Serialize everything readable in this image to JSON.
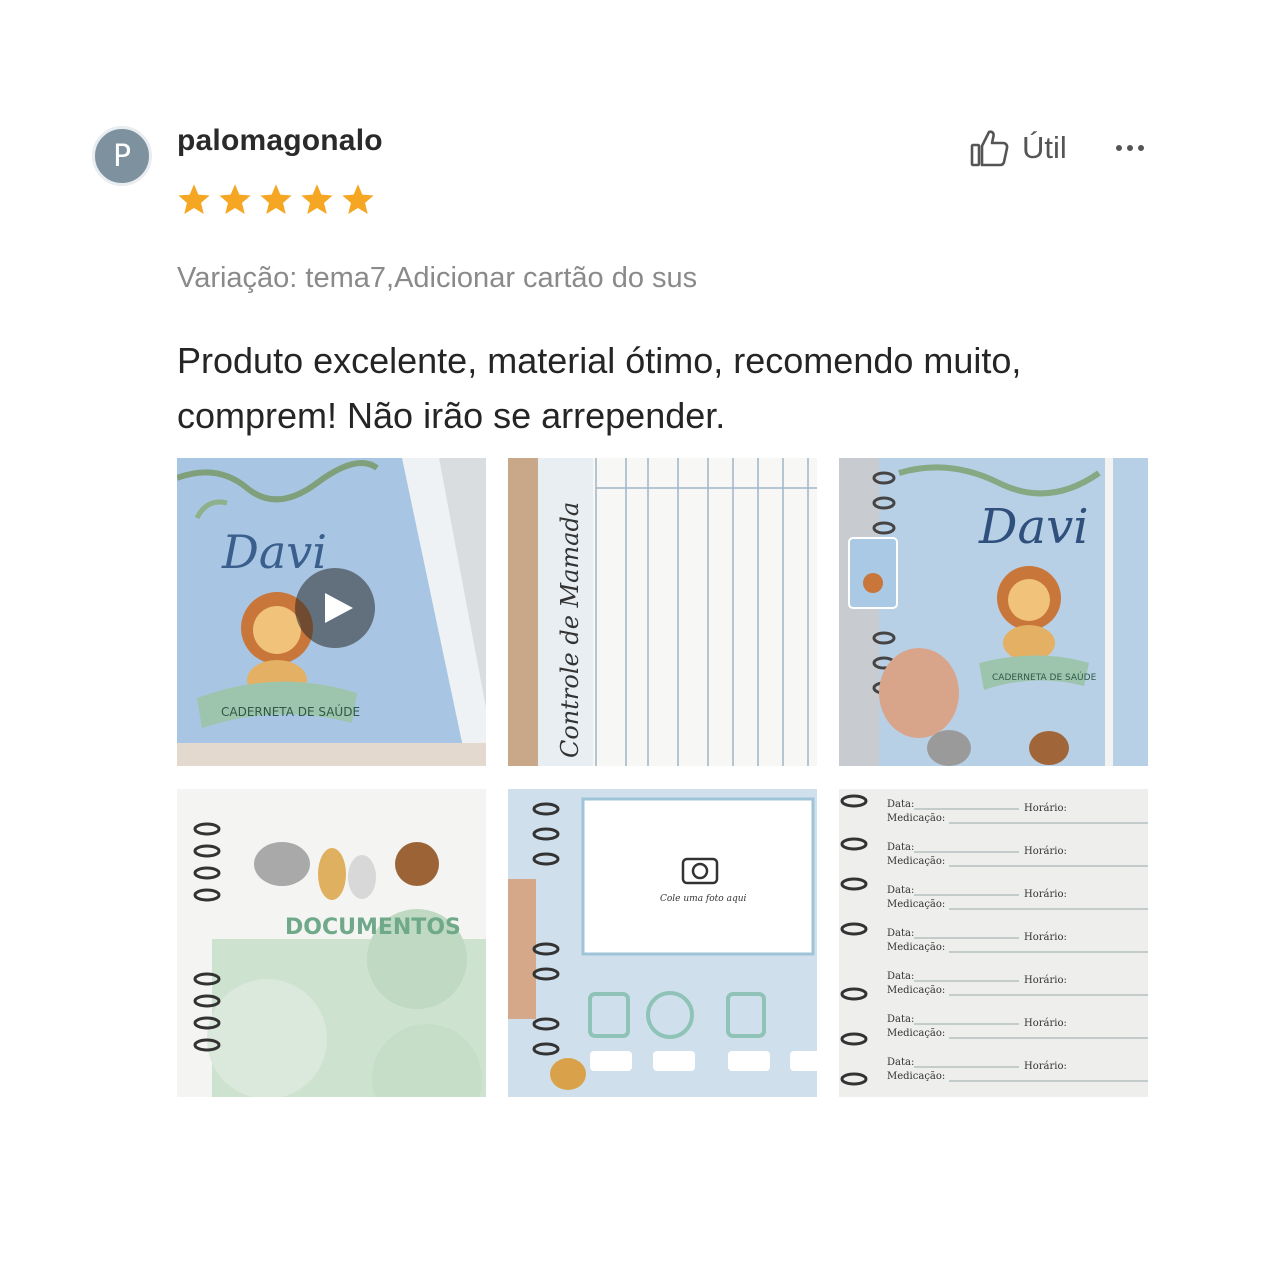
{
  "review": {
    "avatar_letter": "P",
    "username": "palomagonalo",
    "rating": 5,
    "helpful_label": "Útil",
    "variation": "Variação: tema7,Adicionar cartão do sus",
    "comment": "Produto excelente, material ótimo, recomendo muito, comprem! Não irão se arrepender."
  },
  "media": [
    {
      "kind": "video",
      "name_text": "Davi",
      "banner_text": "CADERNETA DE SAÚDE"
    },
    {
      "kind": "image",
      "heading_text": "Controle de Mamada"
    },
    {
      "kind": "image",
      "name_text": "Davi",
      "banner_text": "CADERNETA DE SAÚDE"
    },
    {
      "kind": "image",
      "heading_text": "DOCUMENTOS"
    },
    {
      "kind": "image",
      "caption_text": "Cole uma foto aqui"
    },
    {
      "kind": "image",
      "rows": [
        "Data:",
        "Medicação:",
        "Horário:"
      ]
    }
  ],
  "colors": {
    "star": "#f5a623",
    "avatar": "#7d919e",
    "text_muted": "#8a8a8a"
  },
  "icons": [
    "thumbs-up-icon",
    "more-options-icon",
    "star-icon",
    "play-icon"
  ]
}
